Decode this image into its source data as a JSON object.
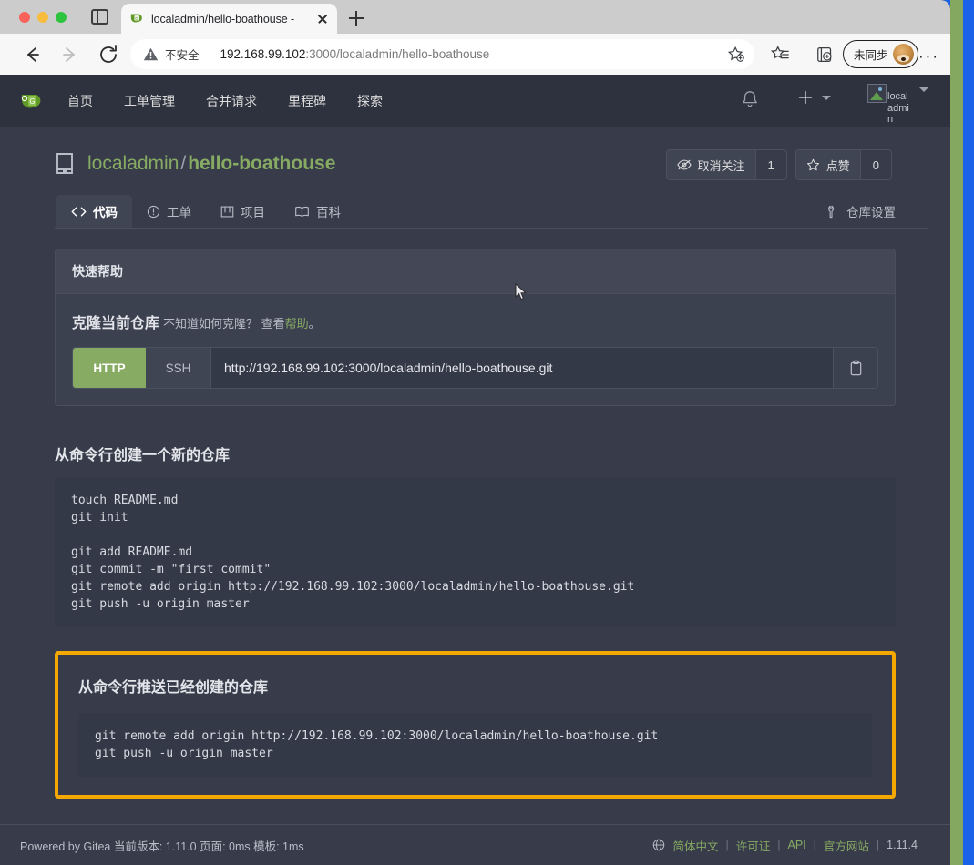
{
  "browser": {
    "tab": {
      "title": "localadmin/hello-boathouse - ",
      "favicon_name": "gitea-favicon",
      "close_label": "×"
    },
    "new_tab_label": "+",
    "toolbar": {
      "back_label": "←",
      "forward_label": "→",
      "reload_label": "⟳",
      "security_label": "不安全",
      "url_host": "192.168.99.102",
      "url_rest": ":3000/localadmin/hello-boathouse",
      "url_full": "192.168.99.102:3000/localadmin/hello-boathouse",
      "profile_label": "未同步",
      "overflow_label": "···"
    }
  },
  "gitea": {
    "nav": {
      "logo_name": "gitea-logo",
      "links": [
        {
          "label": "首页"
        },
        {
          "label": "工单管理"
        },
        {
          "label": "合并请求"
        },
        {
          "label": "里程碑"
        },
        {
          "label": "探索"
        }
      ],
      "user_alt": "localadmin"
    },
    "repo": {
      "owner": "localadmin",
      "separator": "/",
      "name": "hello-boathouse",
      "actions": {
        "watch_label": "取消关注",
        "watch_count": "1",
        "star_label": "点赞",
        "star_count": "0"
      },
      "tabs": [
        {
          "label": "代码",
          "icon": "code-icon",
          "active": true
        },
        {
          "label": "工单",
          "icon": "issue-icon",
          "active": false
        },
        {
          "label": "项目",
          "icon": "projects-icon",
          "active": false
        },
        {
          "label": "百科",
          "icon": "wiki-icon",
          "active": false
        }
      ],
      "settings_label": "仓库设置"
    },
    "quick_help": {
      "header": "快速帮助",
      "clone_title": "克隆当前仓库",
      "clone_hint_before": "不知道如何克隆？ 查看",
      "clone_hint_link": "帮助",
      "clone_hint_after": "。",
      "protocol_http": "HTTP",
      "protocol_ssh": "SSH",
      "clone_url": "http://192.168.99.102:3000/localadmin/hello-boathouse.git",
      "copy_icon": "clipboard-icon"
    },
    "create_section": {
      "title": "从命令行创建一个新的仓库",
      "code": "touch README.md\ngit init\n\ngit add README.md\ngit commit -m \"first commit\"\ngit remote add origin http://192.168.99.102:3000/localadmin/hello-boathouse.git\ngit push -u origin master"
    },
    "push_section": {
      "title": "从命令行推送已经创建的仓库",
      "code": "git remote add origin http://192.168.99.102:3000/localadmin/hello-boathouse.git\ngit push -u origin master",
      "highlight_color": "#f5a800"
    },
    "footer": {
      "left": "Powered by Gitea  当前版本: 1.11.0  页面: 0ms  模板: 1ms",
      "lang": "简体中文",
      "license": "许可证",
      "api": "API",
      "website": "官方网站",
      "version": "1.11.4"
    }
  },
  "colors": {
    "accent_green": "#87ab63",
    "page_bg": "#383c4a",
    "nav_bg": "#2e323e",
    "highlight": "#f5a800"
  }
}
